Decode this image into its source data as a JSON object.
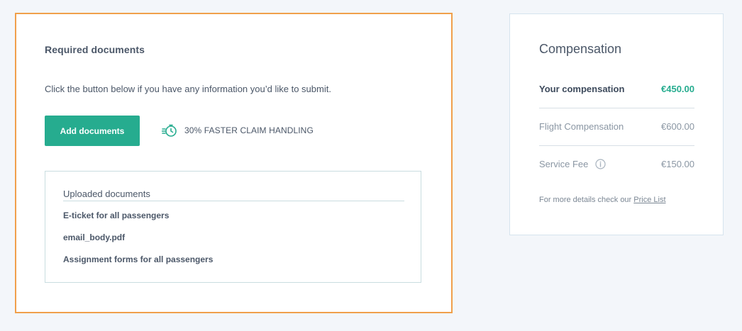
{
  "documents": {
    "title": "Required documents",
    "description": "Click the button below if you have any information you’d like to submit.",
    "add_button_label": "Add documents",
    "fast_badge_text": "30% FASTER CLAIM HANDLING",
    "fast_badge_icon": "fast-stopwatch-icon",
    "uploaded_header": "Uploaded documents",
    "uploaded_items": [
      "E-ticket for all passengers",
      "email_body.pdf",
      "Assignment forms for all passengers"
    ]
  },
  "compensation": {
    "title": "Compensation",
    "rows": [
      {
        "label": "Your compensation",
        "value": "€450.00"
      },
      {
        "label": "Flight Compensation",
        "value": "€600.00"
      },
      {
        "label": "Service Fee",
        "value": "€150.00",
        "icon": "info-icon"
      }
    ],
    "note_prefix": "For more details check our ",
    "note_link": "Price List"
  },
  "colors": {
    "accent": "#26ac8f",
    "highlight_border": "#f0a04b",
    "background": "#f3f6fa"
  }
}
